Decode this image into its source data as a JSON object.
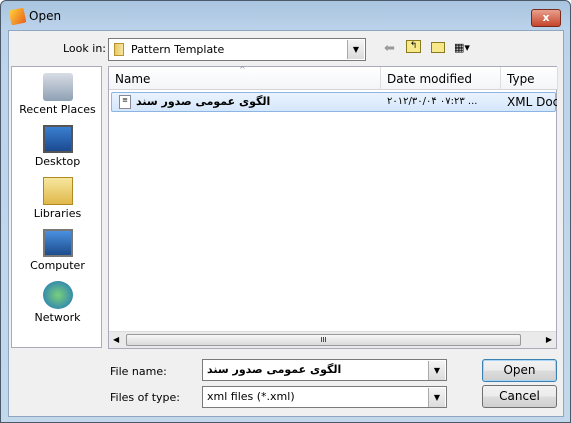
{
  "window": {
    "title": "Open",
    "close": "x"
  },
  "look_in": {
    "label": "Look in:",
    "value": "Pattern Template"
  },
  "toolbar": {
    "back": "back-icon",
    "up": "up-folder-icon",
    "new_folder": "new-folder-icon",
    "views": "views-menu-icon"
  },
  "places": [
    {
      "label": "Recent Places"
    },
    {
      "label": "Desktop"
    },
    {
      "label": "Libraries"
    },
    {
      "label": "Computer"
    },
    {
      "label": "Network"
    }
  ],
  "columns": [
    "Name",
    "Date modified",
    "Type"
  ],
  "files": [
    {
      "name": "الگوی عمومی صدور سند",
      "date": "۲۰۱۲/۳۰/۰۴ ۰۷:۲۳ ...",
      "type": "XML Docu"
    }
  ],
  "file_name": {
    "label": "File name:",
    "value": "الگوی عمومی صدور سند"
  },
  "file_type": {
    "label": "Files of type:",
    "value": "xml files (*.xml)"
  },
  "buttons": {
    "open": "Open",
    "cancel": "Cancel"
  },
  "scroll_grip": "III"
}
